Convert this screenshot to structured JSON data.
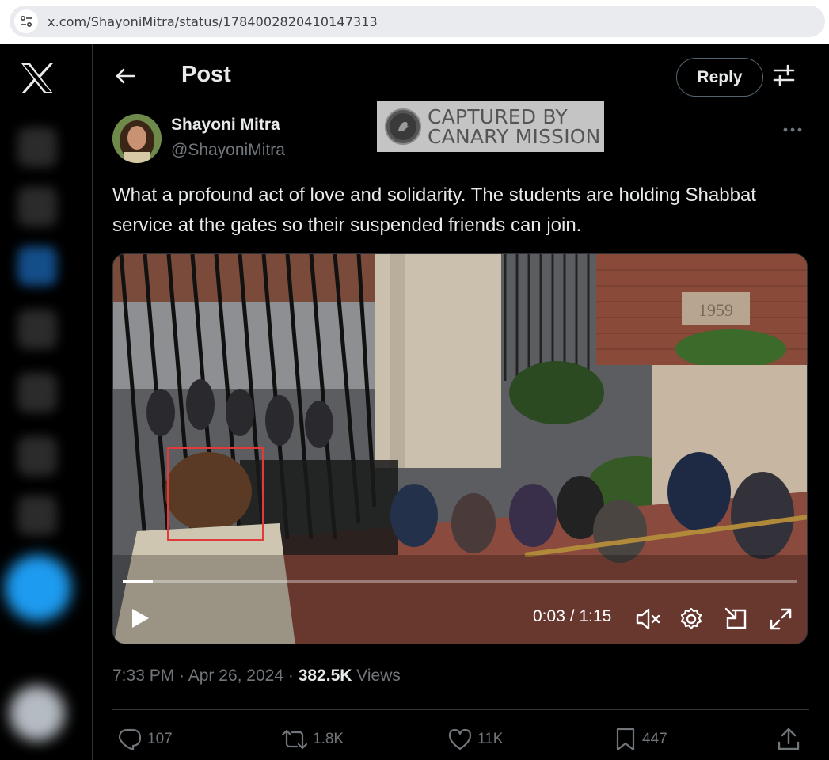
{
  "browser": {
    "url": "x.com/ShayoniMitra/status/1784002820410147313"
  },
  "header": {
    "title": "Post",
    "reply_label": "Reply"
  },
  "author": {
    "name": "Shayoni Mitra",
    "handle": "@ShayoniMitra"
  },
  "watermark": {
    "line1": "CAPTURED BY",
    "line2": "CANARY MISSION"
  },
  "tweet": {
    "text": "What a profound act of love and solidarity. The students are holding Shabbat service at the gates so their suspended friends can join."
  },
  "video": {
    "time": "0:03 / 1:15",
    "progress": 0.045,
    "plaque": "1959"
  },
  "meta": {
    "time": "7:33 PM",
    "date": "Apr 26, 2024",
    "views_count": "382.5K",
    "views_label": "Views",
    "separator": "·"
  },
  "actions": {
    "replies": "107",
    "reposts": "1.8K",
    "likes": "11K",
    "bookmarks": "447"
  },
  "colors": {
    "background": "#000000",
    "text": "#e7e9ea",
    "muted": "#71767b",
    "accent": "#1d9bf0",
    "highlight": "#e03a3a"
  }
}
